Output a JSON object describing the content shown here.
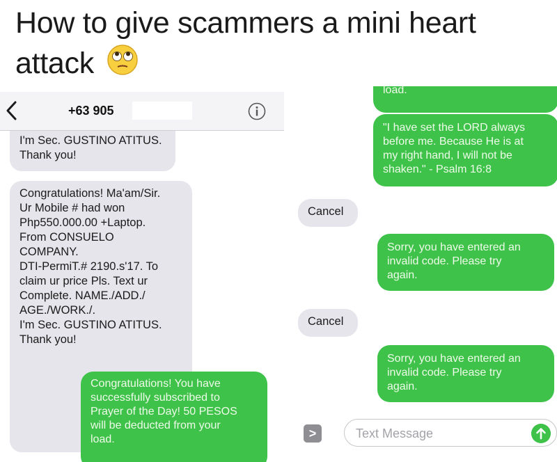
{
  "caption": {
    "text": "How to give scammers a mini heart attack",
    "emoji": "eye-roll-emoji-icon"
  },
  "conversation_left": {
    "header": {
      "back_icon": "chevron-left-icon",
      "contact": "+63 905",
      "info_icon": "info-icon"
    },
    "messages": [
      {
        "from": "them",
        "text": "I'm Sec. GUSTINO ATITUS.\nThank you!"
      },
      {
        "from": "them",
        "text": "Congratulations! Ma'am/Sir.\nUr Mobile # had won\nPhp550.000.00 +Laptop.\nFrom CONSUELO\nCOMPANY.\nDTI-PermiT.# 2190.s'17. To\nclaim ur price Pls. Text ur\nComplete. NAME./ADD./\nAGE./WORK./.\nI'm Sec. GUSTINO ATITUS.\nThank you!"
      },
      {
        "from": "me",
        "text": "Congratulations! You have\nsuccessfully subscribed to\nPrayer of the Day! 50 PESOS\nwill be deducted from your\nload."
      }
    ]
  },
  "conversation_right": {
    "messages": [
      {
        "from": "me",
        "text": "load."
      },
      {
        "from": "me",
        "text": "\"I have set the LORD always\nbefore me. Because He is at\nmy right hand, I will not be\nshaken.\" - Psalm 16:8"
      },
      {
        "from": "them",
        "text": "Cancel"
      },
      {
        "from": "me",
        "text": "Sorry, you have entered an\ninvalid code. Please try\nagain."
      },
      {
        "from": "them",
        "text": "Cancel"
      },
      {
        "from": "me",
        "text": "Sorry, you have entered an\ninvalid code. Please try\nagain."
      }
    ],
    "input": {
      "placeholder": "Text Message",
      "expand_label": ">",
      "send_icon": "arrow-up-icon"
    }
  },
  "colors": {
    "sms_green": "#3fc24a",
    "gray_bubble": "#e6e5eb",
    "nav_bar": "#f4f4f6"
  }
}
